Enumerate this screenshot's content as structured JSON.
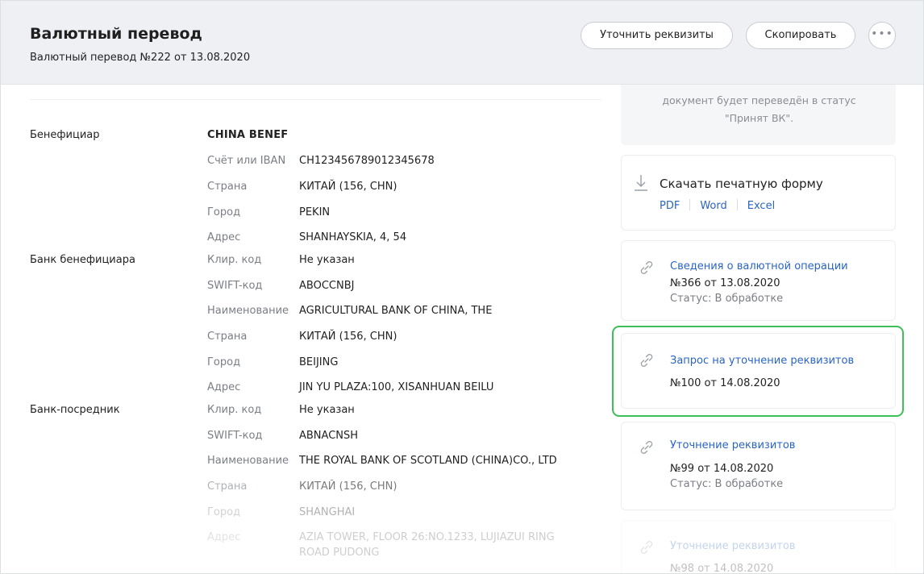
{
  "header": {
    "title": "Валютный перевод",
    "subtitle": "Валютный перевод №222 от 13.08.2020",
    "buttons": {
      "clarify": "Уточнить реквизиты",
      "copy": "Скопировать",
      "more": "•••"
    }
  },
  "beneficiary": {
    "label": "Бенефициар",
    "name": "CHINA BENEF",
    "fields": [
      {
        "key": "Счёт или IBAN",
        "value": "CH123456789012345678"
      },
      {
        "key": "Страна",
        "value": "КИТАЙ (156, CHN)"
      },
      {
        "key": "Город",
        "value": "PEKIN"
      },
      {
        "key": "Адрес",
        "value": "SHANHAYSKIA, 4, 54"
      }
    ]
  },
  "beneficiary_bank": {
    "label": "Банк бенефициара",
    "fields": [
      {
        "key": "Клир. код",
        "value": "Не указан"
      },
      {
        "key": "SWIFT-код",
        "value": "ABOCCNBJ"
      },
      {
        "key": "Наименование",
        "value": "AGRICULTURAL BANK OF CHINA, THE"
      },
      {
        "key": "Страна",
        "value": "КИТАЙ (156, CHN)"
      },
      {
        "key": "Город",
        "value": "BEIJING"
      },
      {
        "key": "Адрес",
        "value": "JIN YU PLAZA:100, XISANHUAN BEILU"
      }
    ]
  },
  "intermediary_bank": {
    "label": "Банк-посредник",
    "fields": [
      {
        "key": "Клир. код",
        "value": "Не указан"
      },
      {
        "key": "SWIFT-код",
        "value": "ABNACNSH"
      },
      {
        "key": "Наименование",
        "value": "THE ROYAL BANK OF SCOTLAND (CHINA)CO., LTD"
      },
      {
        "key": "Страна",
        "value": "КИТАЙ (156, CHN)"
      },
      {
        "key": "Город",
        "value": "SHANGHAI"
      },
      {
        "key": "Адрес",
        "value": "AZIA TOWER, FLOOR 26:NO.1233, LUJIAZUI RING",
        "value2": "ROAD PUDONG"
      }
    ]
  },
  "sidebar": {
    "note": {
      "line1": "документ будет переведён в статус",
      "line2": "\"Принят ВК\"."
    },
    "print": {
      "title": "Скачать печатную форму",
      "pdf": "PDF",
      "word": "Word",
      "excel": "Excel"
    },
    "links": [
      {
        "title": "Сведения о валютной операции",
        "number": "№366 от 13.08.2020",
        "status": "Статус: В обработке"
      },
      {
        "title": "Запрос на уточнение реквизитов",
        "number": "№100 от 14.08.2020"
      },
      {
        "title": "Уточнение реквизитов",
        "number": "№99 от 14.08.2020",
        "status": "Статус: В обработке"
      },
      {
        "title": "Уточнение реквизитов",
        "number": "№98 от 14.08.2020"
      }
    ]
  },
  "colors": {
    "accent_link": "#2a64c5",
    "highlight": "#3fbf5a",
    "header_bg": "#eff0f3"
  }
}
